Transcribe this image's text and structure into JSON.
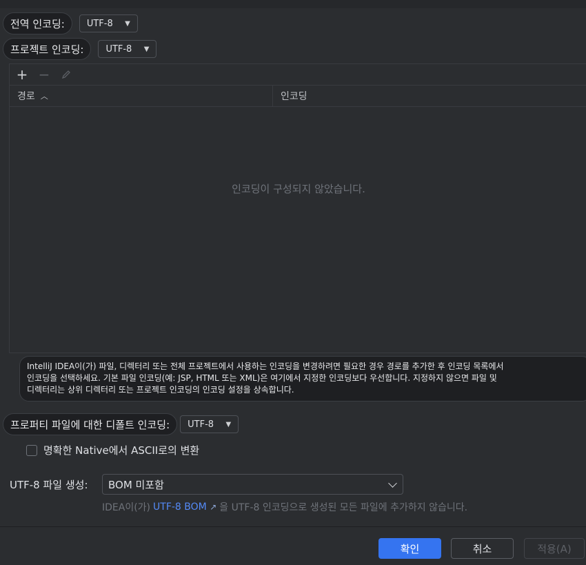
{
  "global_encoding": {
    "label": "전역 인코딩:",
    "value": "UTF-8"
  },
  "project_encoding": {
    "label": "프로젝트 인코딩:",
    "value": "UTF-8"
  },
  "table": {
    "columns": {
      "path": "경로",
      "encoding": "인코딩"
    },
    "empty_text": "인코딩이 구성되지 않았습니다."
  },
  "note": {
    "line1": "IntelliJ IDEA이(가) 파일, 디렉터리 또는 전체 프로젝트에서 사용하는 인코딩을 변경하려면 필요한 경우 경로를 추가한 후 인코딩 목록에서",
    "line2": "인코딩을 선택하세요. 기본 파일 인코딩(예: JSP, HTML 또는 XML)은 여기에서 지정한 인코딩보다 우선합니다. 지정하지 않으면 파일 및",
    "line3": "디렉터리는 상위 디렉터리 또는 프로젝트 인코딩의 인코딩 설정을 상속합니다."
  },
  "properties_encoding": {
    "label": "프로퍼티 파일에 대한 디폴트 인코딩:",
    "value": "UTF-8"
  },
  "native_ascii": {
    "label": "명확한 Native에서 ASCII로의 변환",
    "checked": false
  },
  "bom": {
    "label": "UTF-8 파일 생성:",
    "value": "BOM 미포함",
    "hint_prefix": "IDEA이(가)",
    "hint_link": "UTF-8 BOM",
    "hint_suffix": "을 UTF-8 인코딩으로 생성된 모든 파일에 추가하지 않습니다."
  },
  "buttons": {
    "ok": "확인",
    "cancel": "취소",
    "apply": "적용(A)"
  },
  "icons": {
    "add": "plus-icon",
    "remove": "minus-icon",
    "edit": "pencil-icon",
    "sort": "chevron-up-icon",
    "external": "external-link-icon"
  },
  "colors": {
    "accent": "#3574f0",
    "link": "#548af7",
    "background": "#2b2d30"
  }
}
